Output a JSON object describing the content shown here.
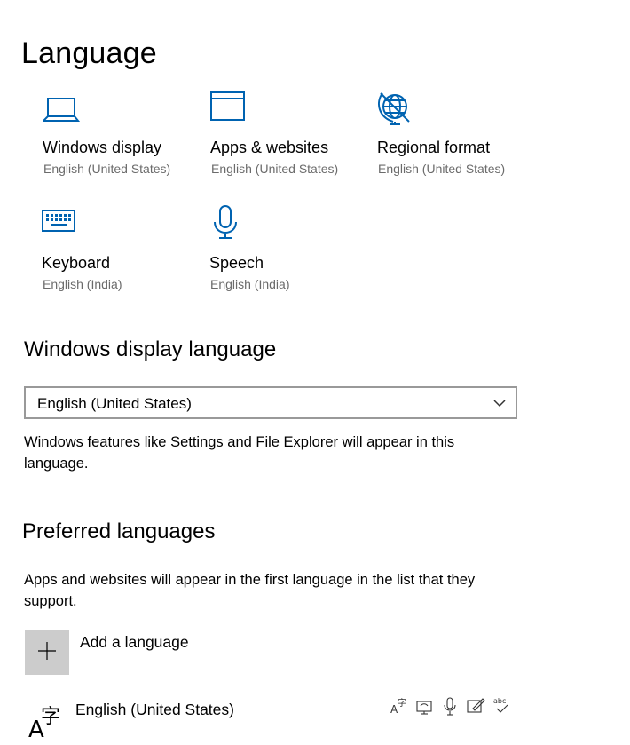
{
  "page": {
    "title": "Language"
  },
  "tiles": [
    {
      "title": "Windows display",
      "subtitle": "English (United States)",
      "icon": "laptop-icon"
    },
    {
      "title": "Apps & websites",
      "subtitle": "English (United States)",
      "icon": "app-window-icon"
    },
    {
      "title": "Regional format",
      "subtitle": "English (United States)",
      "icon": "globe-icon"
    },
    {
      "title": "Keyboard",
      "subtitle": "English (India)",
      "icon": "keyboard-icon"
    },
    {
      "title": "Speech",
      "subtitle": "English (India)",
      "icon": "microphone-icon"
    }
  ],
  "display_language": {
    "heading": "Windows display language",
    "selected": "English (United States)",
    "description": "Windows features like Settings and File Explorer will appear in this language."
  },
  "preferred": {
    "heading": "Preferred languages",
    "description": "Apps and websites will appear in the first language in the list that they support.",
    "add_label": "Add a language",
    "languages": [
      {
        "name": "English (United States)",
        "features": [
          "display-language-icon",
          "text-to-speech-icon",
          "speech-recognition-icon",
          "handwriting-icon",
          "spell-check-icon"
        ]
      }
    ]
  },
  "colors": {
    "accent": "#0063B1",
    "subtext": "#6B6B6B",
    "border": "#999999",
    "button": "#CCCCCC"
  }
}
